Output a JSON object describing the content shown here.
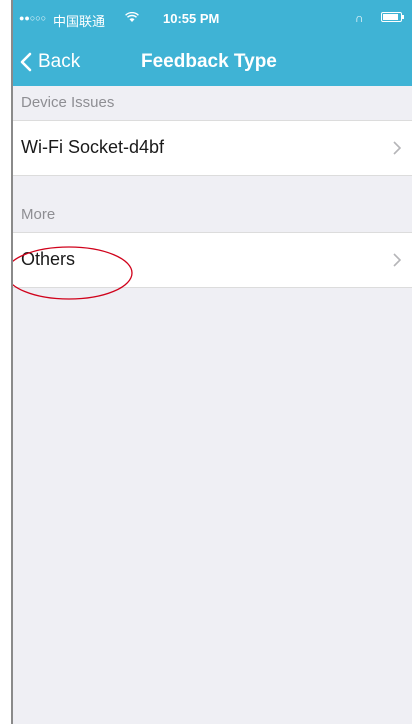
{
  "status_bar": {
    "signal": "●●○○○",
    "carrier": "中国联通",
    "time": "10:55 PM",
    "right_indicator": "∩"
  },
  "nav": {
    "back_label": "Back",
    "title": "Feedback Type"
  },
  "sections": [
    {
      "header": "Device Issues",
      "items": [
        {
          "label": "Wi-Fi Socket-d4bf"
        }
      ]
    },
    {
      "header": "More",
      "items": [
        {
          "label": "Others"
        }
      ]
    }
  ],
  "colors": {
    "accent": "#3fb3d5",
    "background": "#efeff4",
    "annotation": "#d0021b"
  }
}
